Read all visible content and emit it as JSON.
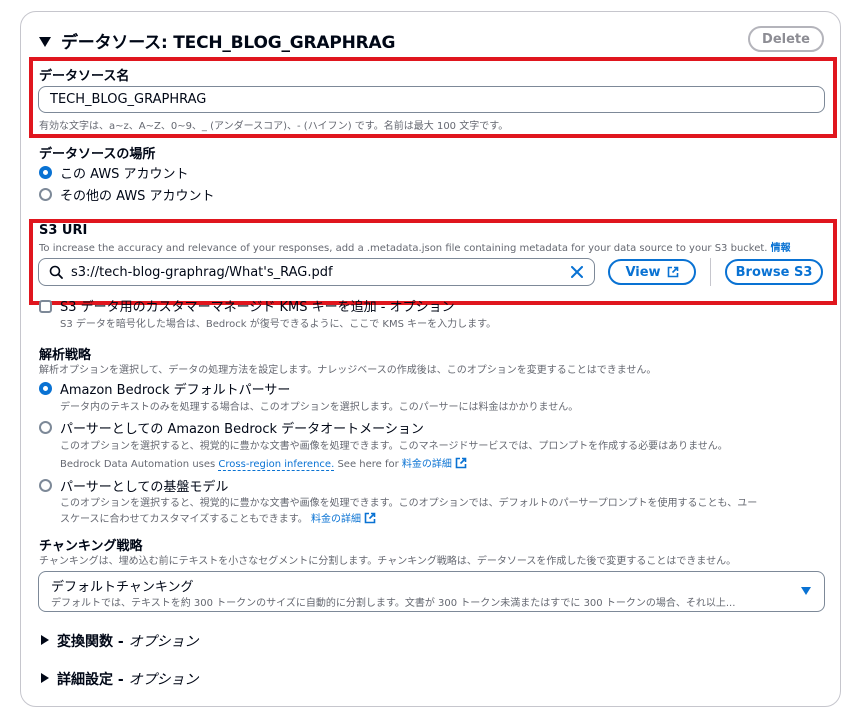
{
  "header": {
    "title": "データソース: TECH_BLOG_GRAPHRAG",
    "delete_label": "Delete"
  },
  "name_field": {
    "label": "データソース名",
    "value": "TECH_BLOG_GRAPHRAG",
    "hint": "有効な文字は、a~z、A~Z、0~9、_ (アンダースコア)、- (ハイフン) です。名前は最大 100 文字です。"
  },
  "location": {
    "label": "データソースの場所",
    "options": [
      {
        "label": "この AWS アカウント",
        "selected": true
      },
      {
        "label": "その他の AWS アカウント",
        "selected": false
      }
    ]
  },
  "s3": {
    "label": "S3 URI",
    "description": "To increase the accuracy and relevance of your responses, add a .metadata.json file containing metadata for your data source to your S3 bucket.",
    "info_link": "情報",
    "value": "s3://tech-blog-graphrag/What's_RAG.pdf",
    "view_label": "View",
    "browse_label": "Browse S3"
  },
  "kms": {
    "label": "S3 データ用のカスタマーマネージド KMS キーを追加 - オプション",
    "description": "S3 データを暗号化した場合は、Bedrock が復号できるように、ここで KMS キーを入力します。"
  },
  "parsing": {
    "label": "解析戦略",
    "description": "解析オプションを選択して、データの処理方法を設定します。ナレッジベースの作成後は、このオプションを変更することはできません。",
    "options": [
      {
        "label": "Amazon Bedrock デフォルトパーサー",
        "description": "データ内のテキストのみを処理する場合は、このオプションを選択します。このパーサーには料金はかかりません。",
        "selected": true
      },
      {
        "label": "パーサーとしての Amazon Bedrock データオートメーション",
        "description": "このオプションを選択すると、視覚的に豊かな文書や画像を処理できます。このマネージドサービスでは、プロンプトを作成する必要はありません。",
        "extra_prefix": "Bedrock Data Automation uses",
        "extra_link": "Cross-region inference.",
        "extra_middle": "See here for",
        "extra_link2": "料金の詳細",
        "selected": false
      },
      {
        "label": "パーサーとしての基盤モデル",
        "description_line1": "このオプションを選択すると、視覚的に豊かな文書や画像を処理できます。このオプションでは、デフォルトのパーサープロンプトを使用することも、ユー",
        "description_line2": "スケースに合わせてカスタマイズすることもできます。",
        "link": "料金の詳細",
        "selected": false
      }
    ]
  },
  "chunking": {
    "label": "チャンキング戦略",
    "description": "チャンキングは、埋め込む前にテキストを小さなセグメントに分割します。チャンキング戦略は、データソースを作成した後で変更することはできません。",
    "selected": "デフォルトチャンキング",
    "selected_desc": "デフォルトでは、テキストを約 300 トークンのサイズに自動的に分割します。文書が 300 トークン未満またはすでに 300 トークンの場合、それ以上..."
  },
  "sections": {
    "transform": "変換関数",
    "advanced": "詳細設定",
    "optional": "オプション"
  },
  "colors": {
    "accent": "#0972d3",
    "highlight": "#e0161e",
    "text": "#000716",
    "muted": "#656871"
  }
}
